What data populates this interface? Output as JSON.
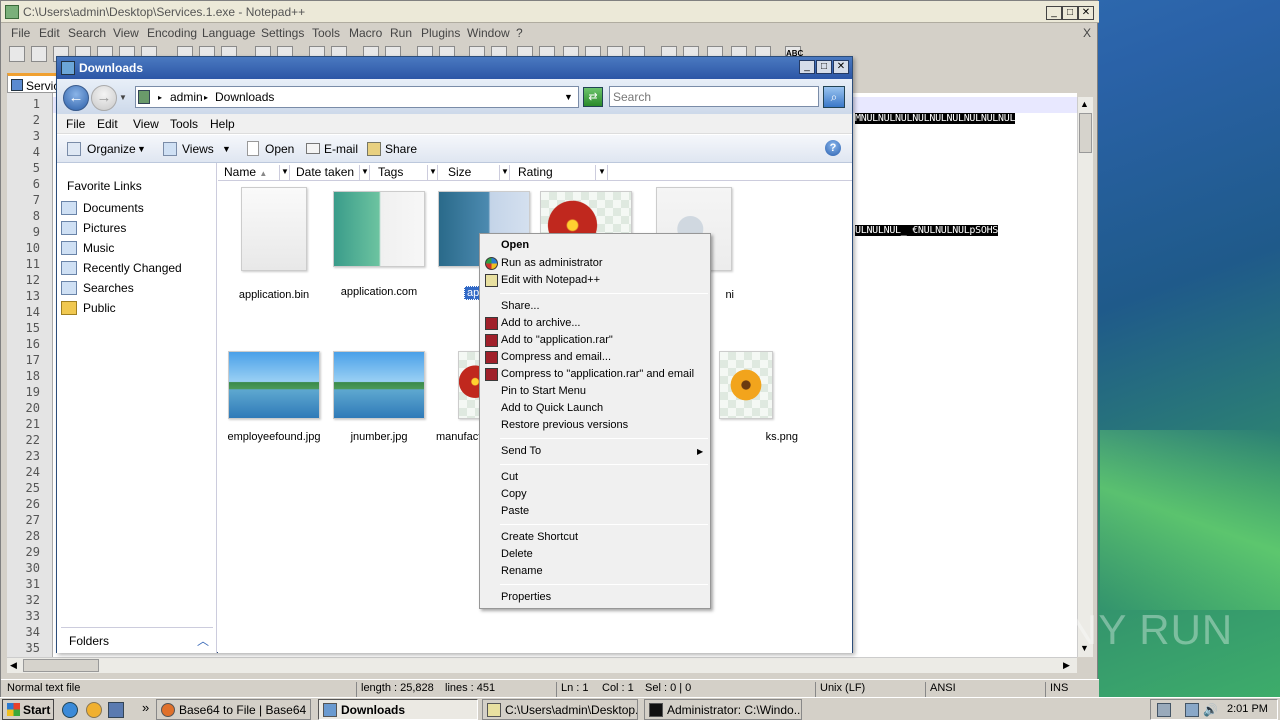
{
  "notepad": {
    "title": "C:\\Users\\admin\\Desktop\\Services.1.exe - Notepad++",
    "menu": [
      "File",
      "Edit",
      "Search",
      "View",
      "Encoding",
      "Language",
      "Settings",
      "Tools",
      "Macro",
      "Run",
      "Plugins",
      "Window",
      "?"
    ],
    "close_x": "X",
    "tab_label": "Servic",
    "line_numbers": [
      "1",
      "2",
      "3",
      "4",
      "5",
      "6",
      "7",
      "8",
      "9",
      "10",
      "11",
      "12",
      "13",
      "14",
      "15",
      "16",
      "17",
      "18",
      "19",
      "20",
      "21",
      "22",
      "23",
      "24",
      "25",
      "26",
      "27",
      "28",
      "29",
      "30",
      "31",
      "32",
      "33",
      "34",
      "35"
    ],
    "line2_text": "MNULNULNULNULNULNULNULNULNUL",
    "line9_text": "ULNULNUL_ €NULNULNULpSOHS",
    "status": {
      "type": "Normal text file",
      "length": "length : 25,828",
      "lines": "lines : 451",
      "ln": "Ln : 1",
      "col": "Col : 1",
      "sel": "Sel : 0 | 0",
      "eol": "Unix (LF)",
      "encoding": "ANSI",
      "ins": "INS"
    }
  },
  "explorer": {
    "title": "Downloads",
    "breadcrumb": [
      "admin",
      "Downloads"
    ],
    "search_placeholder": "Search",
    "menu": [
      "File",
      "Edit",
      "View",
      "Tools",
      "Help"
    ],
    "commands": [
      "Organize",
      "Views",
      "Open",
      "E-mail",
      "Share"
    ],
    "favorite_links_heading": "Favorite Links",
    "nav_items": [
      "Documents",
      "Pictures",
      "Music",
      "Recently Changed",
      "Searches",
      "Public"
    ],
    "folders_label": "Folders",
    "columns": [
      "Name",
      "Date taken",
      "Tags",
      "Size",
      "Rating"
    ],
    "files": [
      {
        "name": "application.bin",
        "thumb": "doc"
      },
      {
        "name": "application.com",
        "thumb": "app"
      },
      {
        "name": "applica",
        "thumb": "selected"
      },
      {
        "name": "",
        "thumb": "flower"
      },
      {
        "name": "ni",
        "thumb": "gear"
      },
      {
        "name": "employeefound.jpg",
        "thumb": "land"
      },
      {
        "name": "jnumber.jpg",
        "thumb": "land"
      },
      {
        "name": "manufact",
        "thumb": "flower"
      },
      {
        "name": "ks.png",
        "thumb": "yflower"
      }
    ]
  },
  "context_menu": {
    "items": [
      {
        "label": "Open",
        "bold": true
      },
      {
        "label": "Run as administrator",
        "icon": "shield-icon"
      },
      {
        "label": "Edit with Notepad++",
        "icon": "notepadpp-icon"
      },
      {
        "label": "Share..."
      },
      {
        "label": "Add to archive...",
        "icon": "winrar-icon"
      },
      {
        "label": "Add to \"application.rar\"",
        "icon": "winrar-icon"
      },
      {
        "label": "Compress and email...",
        "icon": "winrar-icon"
      },
      {
        "label": "Compress to \"application.rar\" and email",
        "icon": "winrar-icon"
      },
      {
        "label": "Pin to Start Menu"
      },
      {
        "label": "Add to Quick Launch"
      },
      {
        "label": "Restore previous versions"
      },
      {
        "label": "Send To",
        "submenu": true
      },
      {
        "label": "Cut"
      },
      {
        "label": "Copy"
      },
      {
        "label": "Paste"
      },
      {
        "label": "Create Shortcut"
      },
      {
        "label": "Delete"
      },
      {
        "label": "Rename"
      },
      {
        "label": "Properties"
      }
    ],
    "submenu_arrow": "▶"
  },
  "taskbar": {
    "start_label": "Start",
    "quicklaunch_more": "»",
    "tasks": [
      {
        "label": "Base64 to File | Base64 ...",
        "icon": "firefox-icon"
      },
      {
        "label": "Downloads",
        "icon": "folder-icon",
        "active": true
      },
      {
        "label": "C:\\Users\\admin\\Desktop...",
        "icon": "notepadpp-icon"
      },
      {
        "label": "Administrator: C:\\Windo...",
        "icon": "cmd-icon"
      }
    ],
    "clock": "2:01 PM"
  },
  "watermark": "ANY RUN",
  "colors": {
    "explorer_title": "#2c56a6",
    "selection": "#3169c6",
    "winrar_icon": "#a0202a"
  }
}
